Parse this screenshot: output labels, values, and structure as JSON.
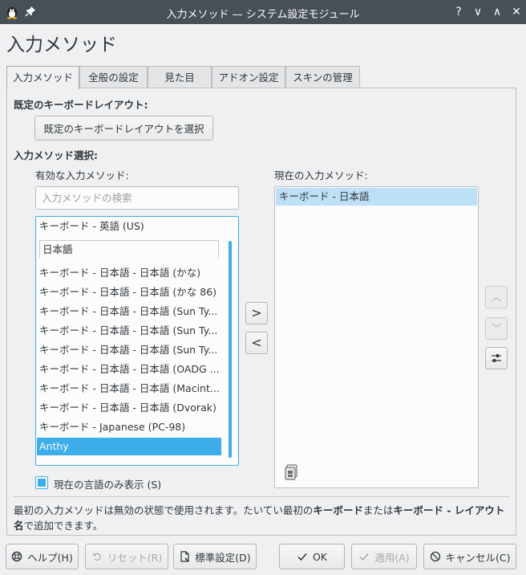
{
  "window": {
    "title": "入力メソッド — システム設定モジュール",
    "help_glyph": "?",
    "min_glyph": "∨",
    "max_glyph": "∧",
    "close_glyph": "✕"
  },
  "page_title": "入力メソッド",
  "tabs": [
    {
      "label": "入力メソッド"
    },
    {
      "label": "全般の設定"
    },
    {
      "label": "見た目"
    },
    {
      "label": "アドオン設定"
    },
    {
      "label": "スキンの管理"
    }
  ],
  "layout_section": {
    "heading": "既定のキーボードレイアウト:",
    "button_label": "既定のキーボードレイアウトを選択"
  },
  "im_section": {
    "heading": "入力メソッド選択:",
    "available_label": "有効な入力メソッド:",
    "current_label": "現在の入力メソッド:",
    "search_placeholder": "入力メソッドの検索",
    "available_items": [
      "キーボード - 英語 (US)",
      "キーボード - 日本語 - 日本語 (かな)",
      "キーボード - 日本語 - 日本語 (かな 86)",
      "キーボード - 日本語 - 日本語 (Sun Ty...",
      "キーボード - 日本語 - 日本語 (Sun Ty...",
      "キーボード - 日本語 - 日本語 (Sun Ty...",
      "キーボード - 日本語 - 日本語 (OADG ...",
      "キーボード - 日本語 - 日本語 (Macint...",
      "キーボード - 日本語 - 日本語 (Dvorak)",
      "キーボード - Japanese (PC-98)",
      "Anthy"
    ],
    "group_header": "日本語",
    "current_items": [
      "キーボード - 日本語"
    ],
    "add_glyph": ">",
    "remove_glyph": "<",
    "up_glyph": "︿",
    "down_glyph": "﹀",
    "checkbox_label": "現在の言語のみ表示 (S)",
    "checkbox_checked": true
  },
  "info": {
    "text_1": "最初の入力メソッドは無効の状態で使用されます。たいてい最初の",
    "bold_1": "キーボード",
    "text_2": "または",
    "bold_2": "キーボード - レイアウト名",
    "text_3": "で追加できます。"
  },
  "bottom_buttons": {
    "help": "ヘルプ(H)",
    "reset": "リセット(R)",
    "defaults": "標準設定(D)",
    "ok": "OK",
    "apply": "適用(A)",
    "cancel": "キャンセル(C)"
  },
  "colors": {
    "accent": "#3daee9",
    "titlebar": "#475057",
    "background": "#eff0f1"
  }
}
